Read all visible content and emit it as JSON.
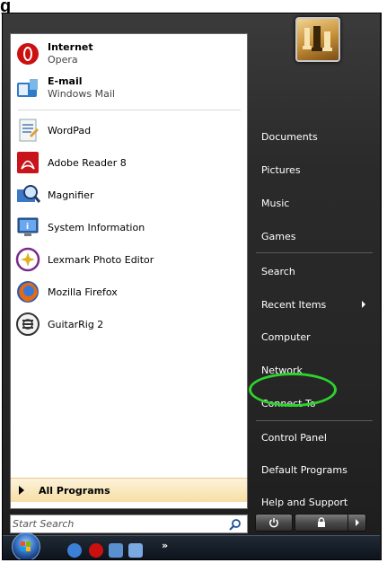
{
  "figure_label": "g",
  "start_menu": {
    "pinned": [
      {
        "name": "Internet",
        "sub": "Opera",
        "icon": "opera-icon"
      },
      {
        "name": "E-mail",
        "sub": "Windows Mail",
        "icon": "windows-mail-icon"
      }
    ],
    "recent": [
      {
        "label": "WordPad",
        "icon": "wordpad-icon"
      },
      {
        "label": "Adobe Reader 8",
        "icon": "adobe-reader-icon"
      },
      {
        "label": "Magnifier",
        "icon": "magnifier-icon"
      },
      {
        "label": "System Information",
        "icon": "system-information-icon"
      },
      {
        "label": "Lexmark Photo Editor",
        "icon": "lexmark-photo-editor-icon"
      },
      {
        "label": "Mozilla Firefox",
        "icon": "firefox-icon"
      },
      {
        "label": "GuitarRig 2",
        "icon": "guitarrig-icon"
      }
    ],
    "all_programs": "All Programs",
    "search_placeholder": "Start Search",
    "right": [
      {
        "label": "Documents"
      },
      {
        "label": "Pictures"
      },
      {
        "label": "Music"
      },
      {
        "label": "Games"
      },
      {
        "label": "Search"
      },
      {
        "label": "Recent Items",
        "has_submenu": true
      },
      {
        "label": "Computer"
      },
      {
        "label": "Network"
      },
      {
        "label": "Connect To",
        "highlighted": true
      },
      {
        "label": "Control Panel"
      },
      {
        "label": "Default Programs"
      },
      {
        "label": "Help and Support"
      }
    ],
    "highlight_color": "#2dd32d"
  },
  "taskbar": {
    "overflow_label": "»"
  }
}
